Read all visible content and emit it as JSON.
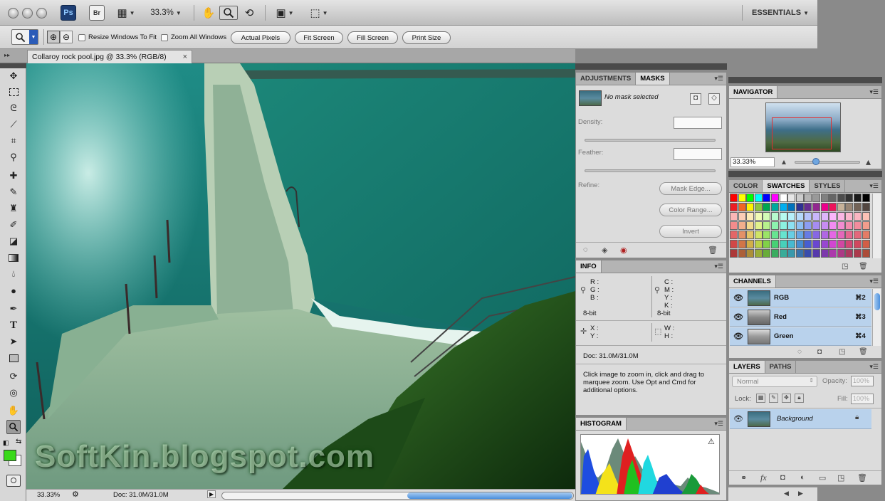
{
  "appbar": {
    "ps_logo": "Ps",
    "br_logo": "Br",
    "zoom_value": "33.3%",
    "workspace": "ESSENTIALS"
  },
  "options": {
    "resize_windows": "Resize Windows To Fit",
    "zoom_all_windows": "Zoom All Windows",
    "actual_pixels": "Actual Pixels",
    "fit_screen": "Fit Screen",
    "fill_screen": "Fill Screen",
    "print_size": "Print Size"
  },
  "document": {
    "tab_title": "Collaroy rock pool.jpg @ 33.3% (RGB/8)",
    "close": "×",
    "watermark": "SoftKin.blogspot.com"
  },
  "status": {
    "zoom": "33.33%",
    "doc": "Doc: 31.0M/31.0M"
  },
  "masks_panel": {
    "tabs": [
      "ADJUSTMENTS",
      "MASKS"
    ],
    "no_mask": "No mask selected",
    "density": "Density:",
    "feather": "Feather:",
    "refine": "Refine:",
    "mask_edge": "Mask Edge...",
    "color_range": "Color Range...",
    "invert": "Invert"
  },
  "info_panel": {
    "tab": "INFO",
    "r": "R :",
    "g": "G :",
    "b": "B :",
    "c": "C :",
    "m": "M :",
    "y": "Y :",
    "k": "K :",
    "bit_left": "8-bit",
    "bit_right": "8-bit",
    "x": "X :",
    "ylab": "Y :",
    "w": "W :",
    "h": "H :",
    "doc": "Doc: 31.0M/31.0M",
    "help": "Click image to zoom in, click and drag to marquee zoom.  Use Opt and Cmd for additional options."
  },
  "histogram_panel": {
    "tab": "HISTOGRAM",
    "warning": "⚠"
  },
  "navigator_panel": {
    "tab": "NAVIGATOR",
    "zoom": "33.33%"
  },
  "color_panel": {
    "tabs": [
      "COLOR",
      "SWATCHES",
      "STYLES"
    ]
  },
  "channels_panel": {
    "tab": "CHANNELS",
    "rows": [
      {
        "name": "RGB",
        "shortcut": "⌘2"
      },
      {
        "name": "Red",
        "shortcut": "⌘3"
      },
      {
        "name": "Green",
        "shortcut": "⌘4"
      }
    ]
  },
  "layers_panel": {
    "tabs": [
      "LAYERS",
      "PATHS"
    ],
    "blend_mode": "Normal",
    "opacity_label": "Opacity:",
    "opacity_value": "100%",
    "lock_label": "Lock:",
    "fill_label": "Fill:",
    "fill_value": "100%",
    "layer_name": "Background"
  },
  "colors": {
    "foreground": "#39d919",
    "accent_selection": "#b9d2ec"
  }
}
